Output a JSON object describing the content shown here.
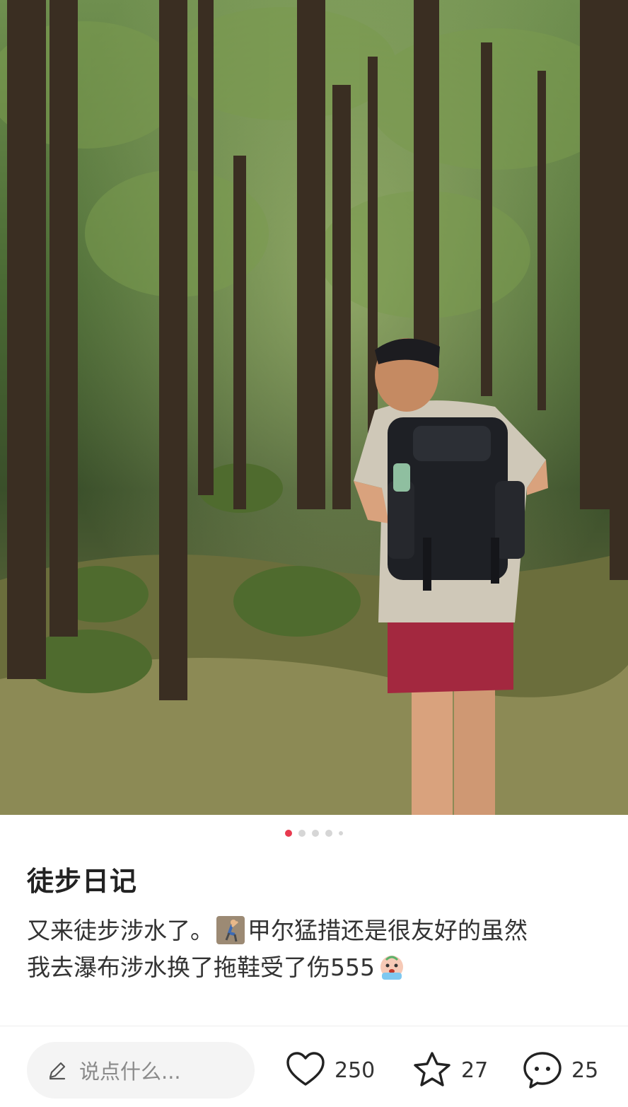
{
  "post": {
    "title": "徒步日记",
    "body_line1_a": "又来徒步涉水了。",
    "body_line1_b": "甲尔猛措还是很友好的虽然",
    "body_line2": "我去瀑布涉水换了拖鞋受了伤555",
    "emoji_1": "climbing-person-emoji",
    "emoji_2": "crying-face-emoji"
  },
  "carousel": {
    "active_index": 1,
    "total_dots": 5
  },
  "bottom_bar": {
    "comment_placeholder": "说点什么...",
    "likes": "250",
    "collects": "27",
    "comments": "25"
  },
  "colors": {
    "accent": "#e83a4f",
    "text": "#222222",
    "placeholder": "#8a8a8a"
  }
}
